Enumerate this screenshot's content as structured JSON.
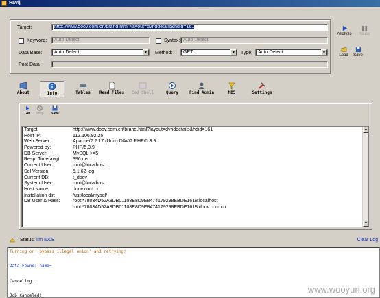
{
  "window": {
    "title": "Havij"
  },
  "form": {
    "target_label": "Target:",
    "target_value": "http://www.doov.com.cn/brand.html?layout=dvhddetails&hdid=161",
    "keyword_label": "Keyword:",
    "keyword_placeholder": "Auto Detect",
    "syntax_label": "Syntax:",
    "syntax_placeholder": "Auto Detect",
    "database_label": "Data Base:",
    "database_value": "Auto Detect",
    "method_label": "Method:",
    "method_value": "GET",
    "type_label": "Type:",
    "type_value": "Auto Detect",
    "postdata_label": "Post Data:"
  },
  "side_buttons": {
    "analyze": "Analyze",
    "pause": "Pause",
    "load": "Load",
    "save": "Save"
  },
  "tabs": [
    {
      "label": "About",
      "icon": "about-icon"
    },
    {
      "label": "Info",
      "icon": "info-icon",
      "active": true
    },
    {
      "label": "Tables",
      "icon": "tables-icon"
    },
    {
      "label": "Read Files",
      "icon": "read-files-icon"
    },
    {
      "label": "Cmd Shell",
      "icon": "cmd-shell-icon",
      "disabled": true
    },
    {
      "label": "Query",
      "icon": "query-icon"
    },
    {
      "label": "Find Admin",
      "icon": "find-admin-icon"
    },
    {
      "label": "MD5",
      "icon": "md5-icon"
    },
    {
      "label": "Settings",
      "icon": "settings-icon"
    }
  ],
  "info_toolbar": {
    "get": "Get",
    "stop": "Stop",
    "save": "Save"
  },
  "info_rows": [
    {
      "key": "Target:",
      "value": "http://www.doov.com.cn/brand.html?layout=dvhddetails&hdid=161"
    },
    {
      "key": "Host IP:",
      "value": "113.106.92.25"
    },
    {
      "key": "Web Server:",
      "value": "Apache/2.2.17 (Unix) DAV/2 PHP/5.3.9"
    },
    {
      "key": "Powered-by:",
      "value": "PHP/5.3.9"
    },
    {
      "key": "DB Server:",
      "value": "MySQL >=5"
    },
    {
      "key": "Resp. Time(avg):",
      "value": "396 ms"
    },
    {
      "key": "Current User:",
      "value": "root@localhost"
    },
    {
      "key": "Sql Version:",
      "value": "5.1.62-log"
    },
    {
      "key": "Current DB:",
      "value": "t_doov"
    },
    {
      "key": "System User:",
      "value": "root@localhost"
    },
    {
      "key": "Host Name:",
      "value": "doov.com.cn"
    },
    {
      "key": "Installation dir:",
      "value": "/usr/local/mysql/"
    },
    {
      "key": "DB User & Pass:",
      "value": "root:*78034D52A8DB01108E8D9E8474179298EBDE1618:localhost"
    },
    {
      "key": "",
      "value": "root:*78034D52A8DB01108E8D9E8474179298EBDE1618:doov.com.cn"
    }
  ],
  "status": {
    "label": "Status:",
    "value": "I'm IDLE",
    "clear_log": "Clear Log"
  },
  "log_lines": [
    {
      "text": "Turning on 'bypass illegal union' and retrying!",
      "color": "#c06000"
    },
    {
      "text": "",
      "color": "#000000"
    },
    {
      "text": "Data Found: name=",
      "color": "#1030c0"
    },
    {
      "text": "",
      "color": "#000000"
    },
    {
      "text": "Canceling...",
      "color": "#000000"
    },
    {
      "text": "",
      "color": "#000000"
    },
    {
      "text": "Job Canceled!",
      "color": "#000000"
    }
  ],
  "watermark": "www.wooyun.org",
  "colors": {
    "title_bar": "#0a246a",
    "selection": "#0a246a",
    "link": "#1030c0",
    "warning": "#c06000"
  }
}
